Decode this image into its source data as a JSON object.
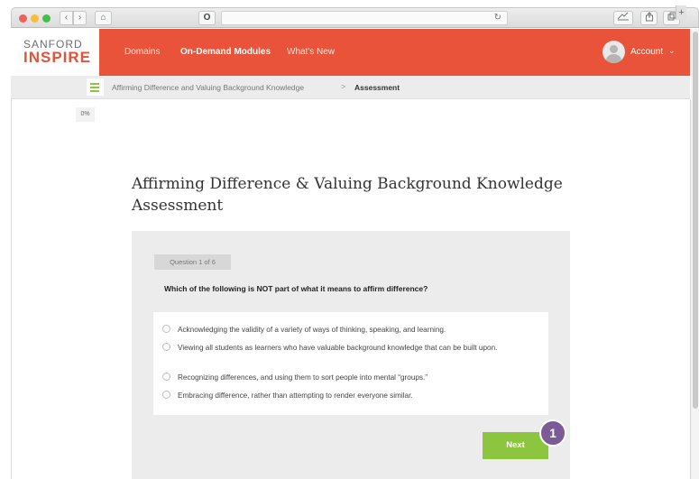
{
  "browser": {
    "nav_back": "‹",
    "nav_forward": "›",
    "home": "⌂",
    "stop": "O",
    "reload": "↻",
    "plus": "+"
  },
  "header": {
    "logo_top": "SANFORD",
    "logo_bottom": "INSPIRE",
    "nav": [
      "Domains",
      "On-Demand Modules",
      "What's New"
    ],
    "account_label": "Account",
    "account_chevron": "⌄",
    "brand_color": "#e8533a"
  },
  "breadcrumb": {
    "module": "Affirming Difference and Valuing Background Knowledge",
    "separator": ">",
    "current": "Assessment",
    "progress": "0%"
  },
  "page": {
    "title": "Affirming Difference & Valuing Background Knowledge Assessment"
  },
  "question": {
    "counter": "Question 1 of 6",
    "text": "Which of the following is NOT part of what it means to affirm difference?",
    "options": [
      "Acknowledging the validity of a variety of ways of thinking, speaking, and learning.",
      "Viewing all students as learners who have valuable background knowledge that can be built upon.",
      "Recognizing differences, and using them to sort people into mental “groups.”",
      "Embracing difference, rather than attempting to render everyone similar."
    ],
    "next_label": "Next",
    "accent_color": "#8cc63f"
  },
  "annotation": {
    "step": "1",
    "color": "#7b5a96"
  }
}
